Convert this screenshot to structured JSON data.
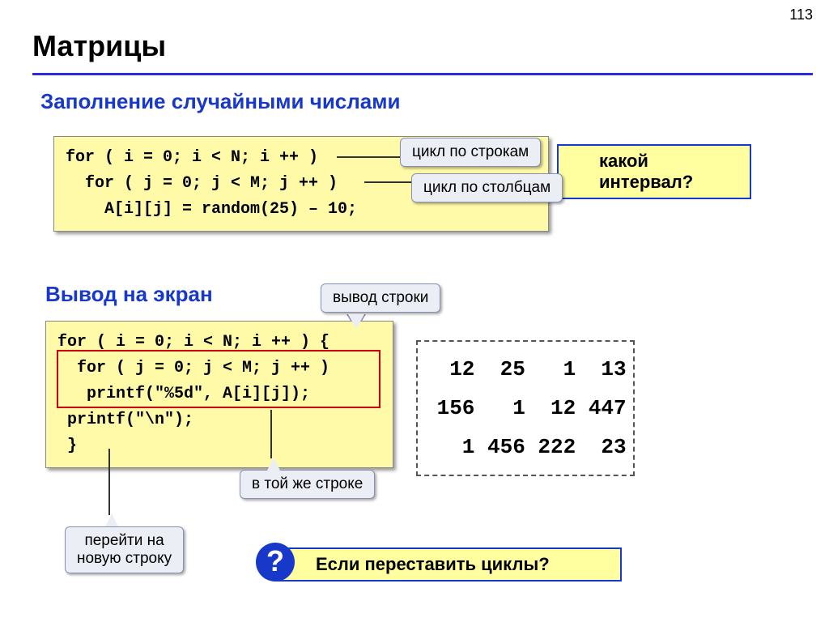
{
  "pageNumber": "113",
  "title": "Матрицы",
  "subtitle1": "Заполнение случайными числами",
  "subtitle2": "Вывод на экран",
  "code1": "for ( i = 0; i < N; i ++ )\n  for ( j = 0; j < M; j ++ )\n    A[i][j] = random(25) – 10;",
  "code2": "for ( i = 0; i < N; i ++ ) {\n  for ( j = 0; j < M; j ++ )\n   printf(\"%5d\", A[i][j]);\n printf(\"\\n\");\n }",
  "callouts": {
    "rows": "цикл по строкам",
    "cols": "цикл по столбцам",
    "outrow": "вывод строки",
    "sameline": "в той же строке",
    "newline": "перейти на\nновую строку"
  },
  "question1": "какой интервал?",
  "question2": "Если переставить циклы?",
  "qmark": "?",
  "matrixText": "  12  25   1  13\n 156   1  12 447\n   1 456 222  23"
}
